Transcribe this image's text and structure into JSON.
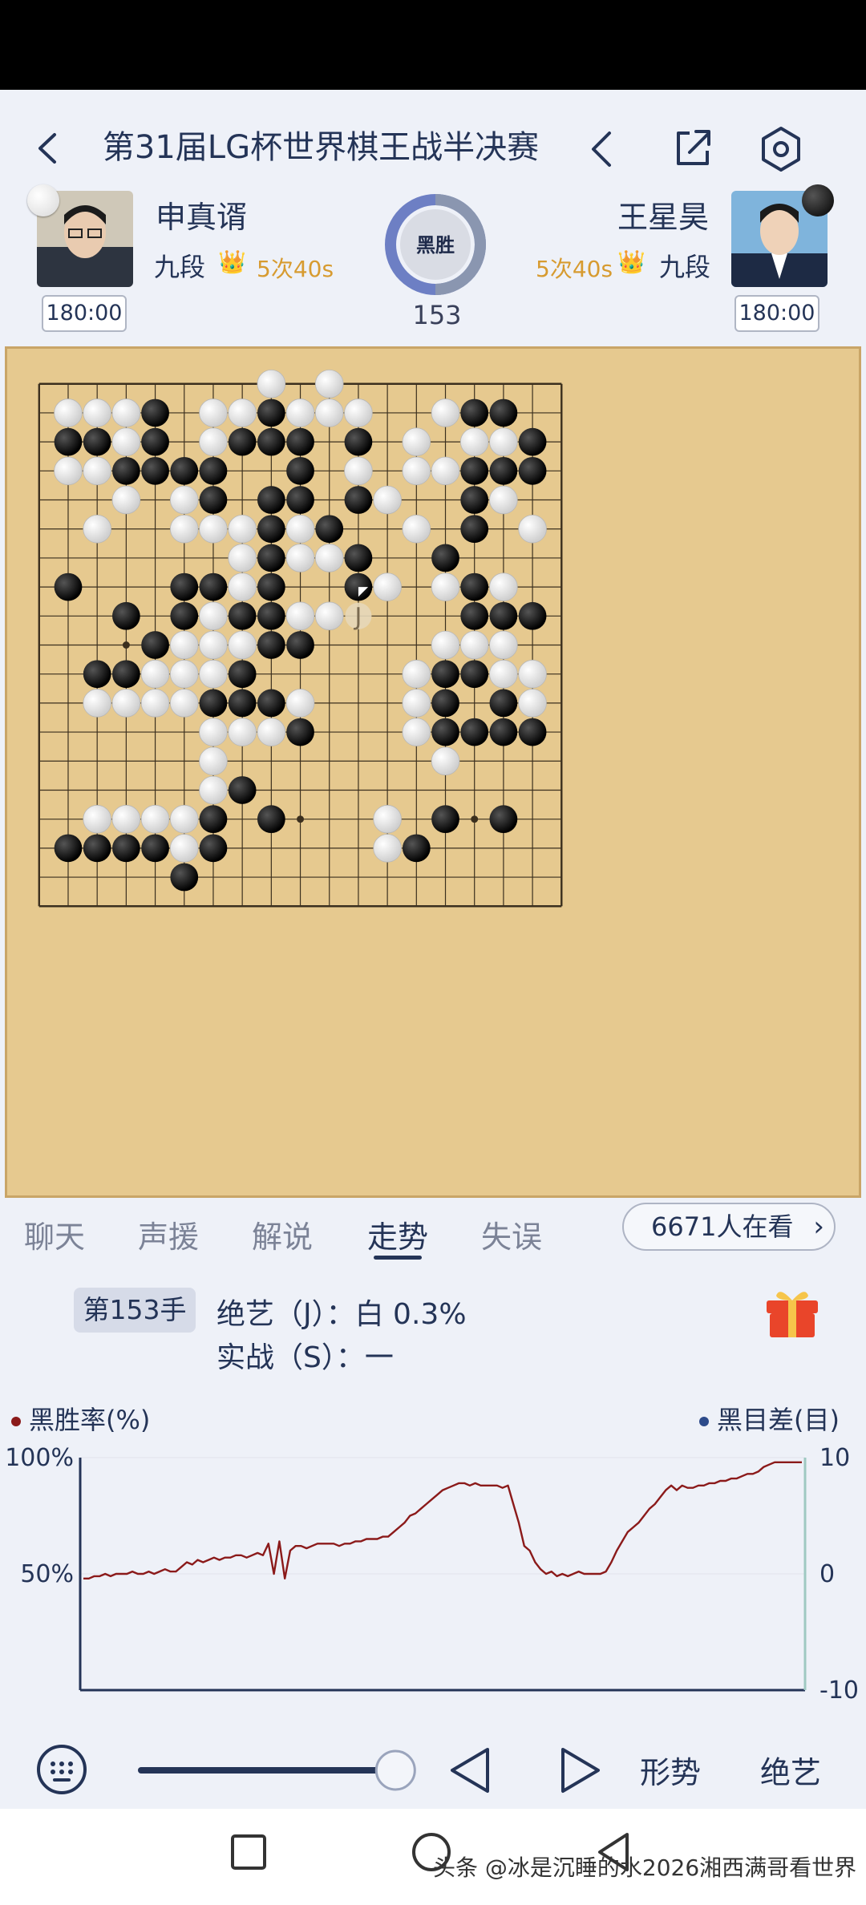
{
  "header": {
    "title": "第31届LG杯世界棋王战半决赛",
    "result_badge": "黑胜",
    "move_count": "153"
  },
  "players": {
    "left": {
      "name": "申真谞",
      "rank": "九段",
      "byoyomi": "5次40s",
      "clock": "180:00",
      "stone": "white"
    },
    "right": {
      "name": "王星昊",
      "rank": "九段",
      "byoyomi": "5次40s",
      "clock": "180:00",
      "stone": "black"
    }
  },
  "board": {
    "size": 19,
    "black": [
      [
        4,
        1
      ],
      [
        8,
        1
      ],
      [
        15,
        1
      ],
      [
        16,
        1
      ],
      [
        1,
        2
      ],
      [
        2,
        2
      ],
      [
        4,
        2
      ],
      [
        7,
        2
      ],
      [
        8,
        2
      ],
      [
        9,
        2
      ],
      [
        11,
        2
      ],
      [
        17,
        2
      ],
      [
        3,
        3
      ],
      [
        4,
        3
      ],
      [
        5,
        3
      ],
      [
        6,
        3
      ],
      [
        9,
        3
      ],
      [
        15,
        3
      ],
      [
        16,
        3
      ],
      [
        17,
        3
      ],
      [
        6,
        4
      ],
      [
        8,
        4
      ],
      [
        9,
        4
      ],
      [
        11,
        4
      ],
      [
        15,
        4
      ],
      [
        8,
        5
      ],
      [
        10,
        5
      ],
      [
        15,
        5
      ],
      [
        8,
        6
      ],
      [
        11,
        6
      ],
      [
        14,
        6
      ],
      [
        1,
        7
      ],
      [
        5,
        7
      ],
      [
        6,
        7
      ],
      [
        8,
        7
      ],
      [
        11,
        7
      ],
      [
        15,
        7
      ],
      [
        3,
        8
      ],
      [
        5,
        8
      ],
      [
        7,
        8
      ],
      [
        8,
        8
      ],
      [
        15,
        8
      ],
      [
        16,
        8
      ],
      [
        17,
        8
      ],
      [
        4,
        9
      ],
      [
        8,
        9
      ],
      [
        9,
        9
      ],
      [
        2,
        10
      ],
      [
        3,
        10
      ],
      [
        7,
        10
      ],
      [
        14,
        10
      ],
      [
        15,
        10
      ],
      [
        6,
        11
      ],
      [
        7,
        11
      ],
      [
        8,
        11
      ],
      [
        14,
        11
      ],
      [
        16,
        11
      ],
      [
        9,
        12
      ],
      [
        14,
        12
      ],
      [
        15,
        12
      ],
      [
        16,
        12
      ],
      [
        17,
        12
      ],
      [
        7,
        14
      ],
      [
        6,
        15
      ],
      [
        8,
        15
      ],
      [
        14,
        15
      ],
      [
        16,
        15
      ],
      [
        1,
        16
      ],
      [
        2,
        16
      ],
      [
        3,
        16
      ],
      [
        4,
        16
      ],
      [
        6,
        16
      ],
      [
        13,
        16
      ],
      [
        5,
        17
      ]
    ],
    "white": [
      [
        8,
        0
      ],
      [
        10,
        0
      ],
      [
        1,
        1
      ],
      [
        2,
        1
      ],
      [
        3,
        1
      ],
      [
        6,
        1
      ],
      [
        7,
        1
      ],
      [
        9,
        1
      ],
      [
        10,
        1
      ],
      [
        11,
        1
      ],
      [
        14,
        1
      ],
      [
        3,
        2
      ],
      [
        6,
        2
      ],
      [
        13,
        2
      ],
      [
        15,
        2
      ],
      [
        16,
        2
      ],
      [
        1,
        3
      ],
      [
        2,
        3
      ],
      [
        11,
        3
      ],
      [
        13,
        3
      ],
      [
        14,
        3
      ],
      [
        3,
        4
      ],
      [
        5,
        4
      ],
      [
        12,
        4
      ],
      [
        16,
        4
      ],
      [
        2,
        5
      ],
      [
        5,
        5
      ],
      [
        6,
        5
      ],
      [
        7,
        5
      ],
      [
        9,
        5
      ],
      [
        13,
        5
      ],
      [
        17,
        5
      ],
      [
        7,
        6
      ],
      [
        9,
        6
      ],
      [
        10,
        6
      ],
      [
        7,
        7
      ],
      [
        12,
        7
      ],
      [
        14,
        7
      ],
      [
        16,
        7
      ],
      [
        6,
        8
      ],
      [
        9,
        8
      ],
      [
        10,
        8
      ],
      [
        5,
        9
      ],
      [
        6,
        9
      ],
      [
        7,
        9
      ],
      [
        14,
        9
      ],
      [
        15,
        9
      ],
      [
        16,
        9
      ],
      [
        4,
        10
      ],
      [
        5,
        10
      ],
      [
        6,
        10
      ],
      [
        13,
        10
      ],
      [
        16,
        10
      ],
      [
        17,
        10
      ],
      [
        2,
        11
      ],
      [
        3,
        11
      ],
      [
        4,
        11
      ],
      [
        5,
        11
      ],
      [
        9,
        11
      ],
      [
        13,
        11
      ],
      [
        17,
        11
      ],
      [
        6,
        12
      ],
      [
        7,
        12
      ],
      [
        8,
        12
      ],
      [
        13,
        12
      ],
      [
        6,
        13
      ],
      [
        14,
        13
      ],
      [
        6,
        14
      ],
      [
        2,
        15
      ],
      [
        3,
        15
      ],
      [
        4,
        15
      ],
      [
        5,
        15
      ],
      [
        12,
        15
      ],
      [
        5,
        16
      ],
      [
        12,
        16
      ]
    ],
    "hoshi": [
      [
        3,
        9
      ],
      [
        9,
        15
      ],
      [
        15,
        15
      ],
      [
        3,
        15
      ],
      [
        9,
        9
      ],
      [
        15,
        9
      ],
      [
        3,
        3
      ],
      [
        9,
        3
      ],
      [
        15,
        3
      ]
    ],
    "last_move": [
      11,
      7
    ],
    "suggestion": {
      "point": [
        11,
        8
      ],
      "label": "J"
    }
  },
  "tabs": [
    "聊天",
    "声援",
    "解说",
    "走势",
    "失误"
  ],
  "active_tab": 3,
  "viewers": "6671人在看",
  "analysis": {
    "move_badge": "第153手",
    "ai_line": "绝艺（J）：白 0.3%",
    "actual_line": "实战（S）：一"
  },
  "chart_data": {
    "type": "line",
    "legend_left": "黑胜率(%)",
    "legend_right": "黑目差(目)",
    "y_left_ticks": [
      "100%",
      "50%"
    ],
    "y_right_ticks": [
      "10",
      "0",
      "-10"
    ],
    "ylim": [
      0,
      100
    ],
    "series": [
      {
        "name": "黑胜率(%)",
        "color": "#8b1a1a",
        "values": [
          48,
          48,
          49,
          49,
          50,
          49,
          50,
          50,
          50,
          51,
          50,
          50,
          51,
          50,
          51,
          52,
          51,
          51,
          53,
          55,
          54,
          56,
          55,
          56,
          57,
          56,
          57,
          57,
          58,
          58,
          57,
          58,
          59,
          58,
          63,
          50,
          64,
          48,
          60,
          62,
          62,
          61,
          62,
          63,
          63,
          63,
          63,
          62,
          63,
          63,
          64,
          64,
          65,
          65,
          65,
          66,
          66,
          68,
          70,
          72,
          75,
          76,
          78,
          80,
          82,
          84,
          86,
          87,
          88,
          89,
          89,
          88,
          89,
          88,
          88,
          88,
          88,
          87,
          88,
          80,
          72,
          62,
          60,
          55,
          52,
          50,
          51,
          49,
          50,
          49,
          50,
          51,
          50,
          50,
          50,
          50,
          51,
          55,
          60,
          64,
          68,
          70,
          72,
          75,
          78,
          80,
          83,
          86,
          88,
          86,
          88,
          87,
          87,
          88,
          88,
          89,
          89,
          90,
          90,
          91,
          91,
          92,
          93,
          93,
          94,
          96,
          97,
          98,
          98,
          98,
          98,
          98,
          98
        ]
      }
    ]
  },
  "controls": {
    "slider_fraction": 0.95,
    "label_situation": "形势",
    "label_ai": "绝艺"
  },
  "watermark": "头条 @冰是沉睡的水2026湘西满哥看世界"
}
